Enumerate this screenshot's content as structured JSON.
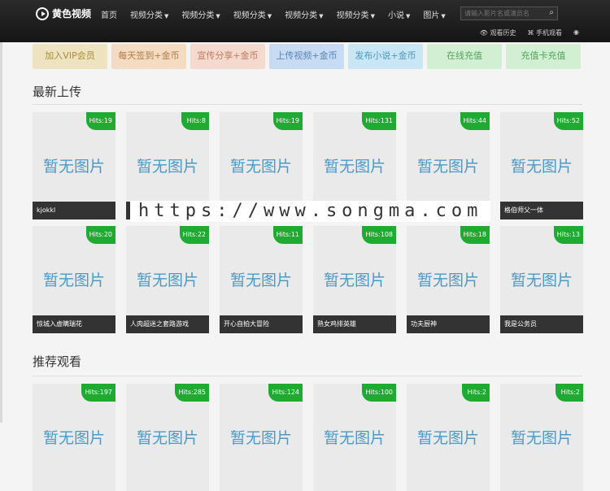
{
  "header": {
    "logo_text": "黄色视频",
    "nav": [
      "首页",
      "视频分类",
      "视频分类",
      "视频分类",
      "视频分类",
      "视频分类",
      "小说",
      "图片"
    ],
    "search_placeholder": "请输入影片名或演员名",
    "links": [
      "观看历史",
      "手机观看"
    ]
  },
  "actions": [
    {
      "label": "加入VIP会员",
      "bg": "#eee3c0",
      "color": "#a98c3a"
    },
    {
      "label": "每天签到+金币",
      "bg": "#f4dcc3",
      "color": "#b07a45"
    },
    {
      "label": "宣传分享+金币",
      "bg": "#f4d9cf",
      "color": "#c07b5c"
    },
    {
      "label": "上传视频+金币",
      "bg": "#c7dbf3",
      "color": "#5b84b6"
    },
    {
      "label": "发布小说+金币",
      "bg": "#c9e6f5",
      "color": "#4d97c0"
    },
    {
      "label": "在线充值",
      "bg": "#d2efd3",
      "color": "#55a45a"
    },
    {
      "label": "充值卡充值",
      "bg": "#d2efd3",
      "color": "#55a45a"
    }
  ],
  "sections": {
    "latest": {
      "title": "最新上传",
      "row1": [
        {
          "hits": "Hits:19",
          "caption": "kjokkl"
        },
        {
          "hits": "Hits:8",
          "caption": ""
        },
        {
          "hits": "Hits:19",
          "caption": ""
        },
        {
          "hits": "Hits:131",
          "caption": ""
        },
        {
          "hits": "Hits:44",
          "caption": ""
        },
        {
          "hits": "Hits:52",
          "caption": "格伯师父一体"
        }
      ],
      "row2": [
        {
          "hits": "Hits:20",
          "caption": "惊城入虚瞒瑞花"
        },
        {
          "hits": "Hits:22",
          "caption": "人肉超迷之套路游戏"
        },
        {
          "hits": "Hits:11",
          "caption": "开心自拍大冒险"
        },
        {
          "hits": "Hits:108",
          "caption": "熟女鸡排英雄"
        },
        {
          "hits": "Hits:18",
          "caption": "功夫厨神"
        },
        {
          "hits": "Hits:13",
          "caption": "我是公务员"
        }
      ]
    },
    "recommended": {
      "title": "推荐观看",
      "row": [
        {
          "hits": "Hits:197"
        },
        {
          "hits": "Hits:285"
        },
        {
          "hits": "Hits:124"
        },
        {
          "hits": "Hits:100"
        },
        {
          "hits": "Hits:2"
        },
        {
          "hits": "Hits:2"
        }
      ]
    }
  },
  "placeholder_text": "暂无图片",
  "watermark": "https://www.songma.com"
}
